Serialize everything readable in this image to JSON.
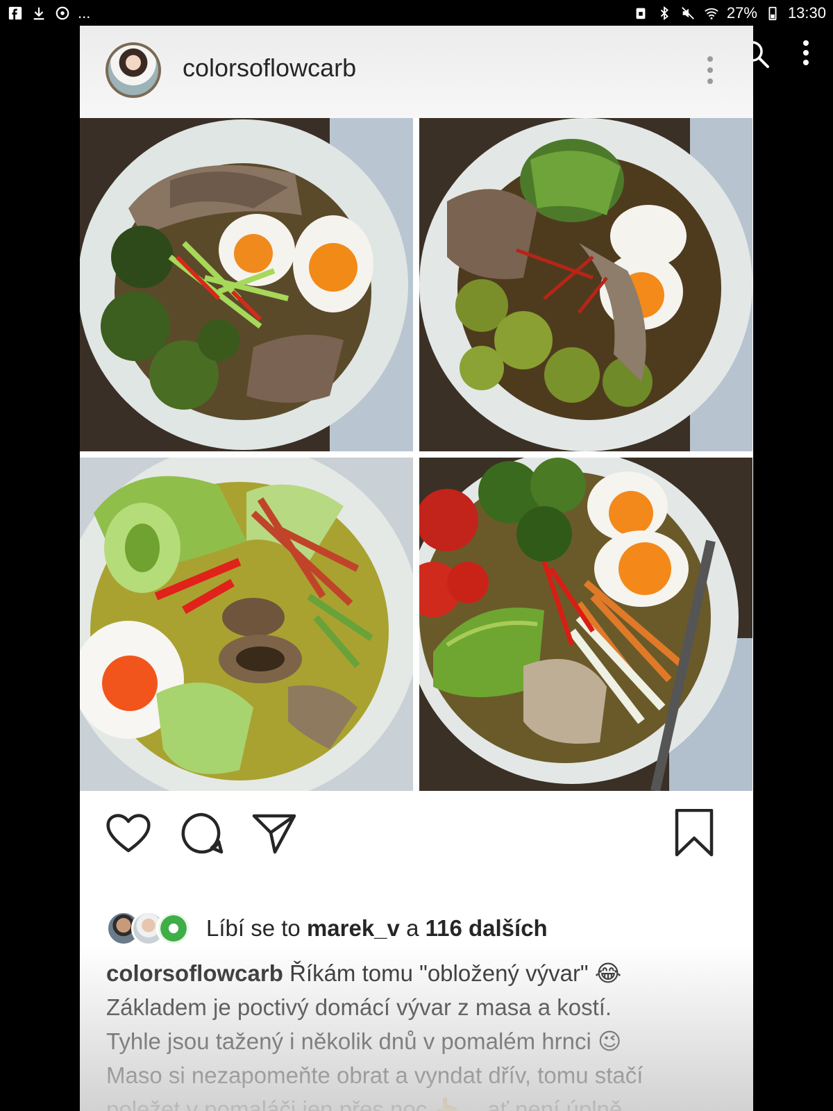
{
  "status_bar": {
    "left_icons": [
      "facebook-icon",
      "download-icon",
      "sync-icon"
    ],
    "ellipsis": "...",
    "battery_percent": "27%",
    "time": "13:30"
  },
  "post": {
    "username": "colorsoflowcarb",
    "images": [
      "mushroom-broccoli-egg-bowl",
      "brussels-sprouts-avocado-bowl",
      "bok-choy-mushroom-egg-bowl",
      "avocado-egg-tomato-bowl"
    ],
    "likes": {
      "prefix": "Líbí se to",
      "user": "marek_v",
      "connector": "a",
      "others": "116 dalších"
    },
    "caption": {
      "user": "colorsoflowcarb",
      "line1": "Říkám tomu \"obložený vývar\" 😂",
      "line2": "Základem je poctivý domácí vývar z masa a kostí.",
      "line3": "Tyhle jsou tažený i několik dnů v pomalém hrnci 😉",
      "line4": "Maso si nezapomeňte obrat a vyndat dřív, tomu stačí",
      "line5": "poležet v pomaláči jen přes noc 👆 ...ať není úplně"
    }
  },
  "colors": {
    "accent_text": "#262626",
    "background": "#000000",
    "card": "#ffffff"
  }
}
